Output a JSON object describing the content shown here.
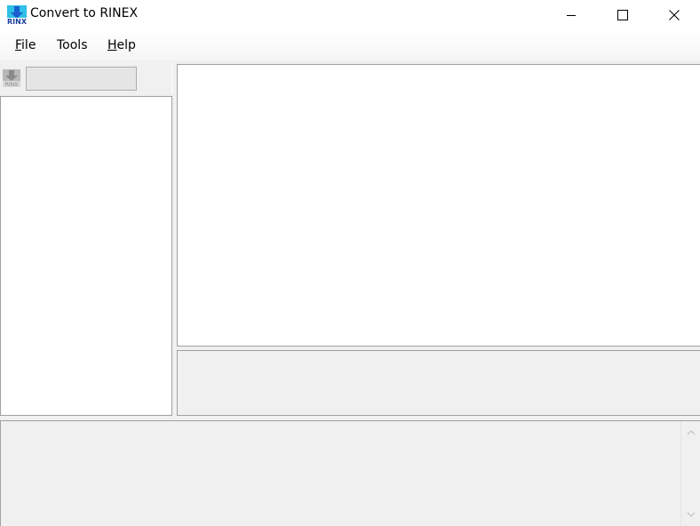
{
  "window": {
    "title": "Convert to RINEX",
    "app_icon": "rinex-download-icon",
    "controls": [
      "minimize-icon",
      "maximize-icon",
      "close-icon"
    ]
  },
  "menu": {
    "items": [
      {
        "label": "File",
        "mnemonic": "F",
        "rest": "ile"
      },
      {
        "label": "Tools",
        "mnemonic": "",
        "rest": "Tools"
      },
      {
        "label": "Help",
        "mnemonic": "H",
        "rest": "elp"
      }
    ]
  },
  "toolbar": {
    "convert_icon": "rinex-convert-icon",
    "combo_value": ""
  },
  "colors": {
    "icon_blue": "#1a5fd0",
    "icon_cyan": "#2ec0e6",
    "window_bg": "#f0f0f0",
    "panel_border": "#a0a0a0"
  }
}
